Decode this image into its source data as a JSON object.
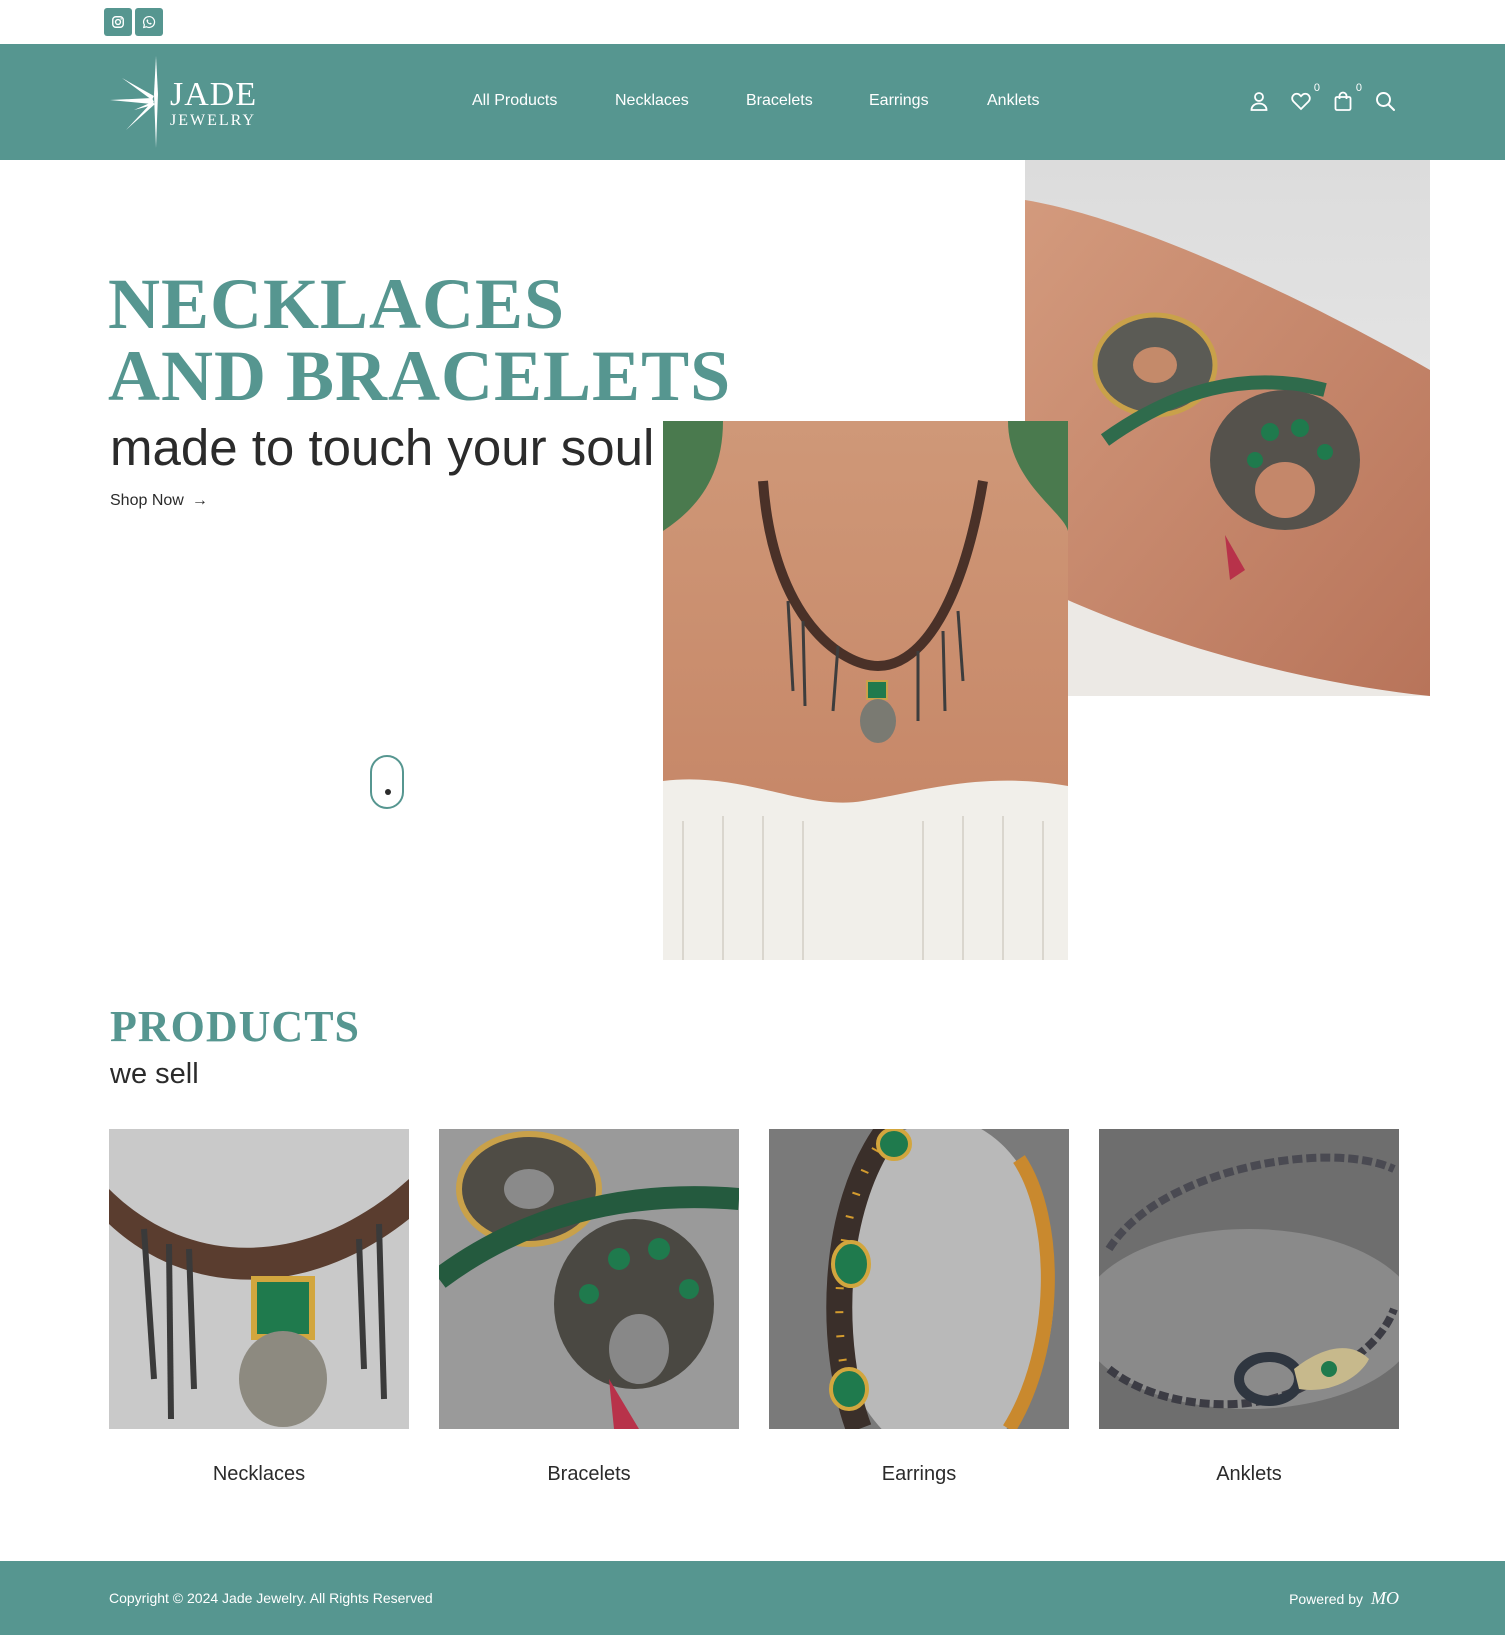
{
  "social": {
    "icons": [
      "instagram-icon",
      "whatsapp-icon"
    ]
  },
  "header": {
    "logo_word": "JADE",
    "logo_sub": "JEWELRY",
    "nav": [
      "All Products",
      "Necklaces",
      "Bracelets",
      "Earrings",
      "Anklets"
    ],
    "wishlist_count": "0",
    "cart_count": "0",
    "icons": [
      "user-icon",
      "heart-icon",
      "bag-icon",
      "search-icon"
    ]
  },
  "hero": {
    "title_line1": "NECKLACES",
    "title_line2": "AND BRACELETS",
    "subtitle": "made to touch your soul",
    "cta": "Shop Now",
    "cta_arrow": "→"
  },
  "products": {
    "title": "PRODUCTS",
    "subtitle": "we sell",
    "items": [
      {
        "label": "Necklaces"
      },
      {
        "label": "Bracelets"
      },
      {
        "label": "Earrings"
      },
      {
        "label": "Anklets"
      }
    ]
  },
  "footer": {
    "copyright": "Copyright © 2024 Jade Jewelry. All Rights Reserved",
    "powered_by": "Powered by",
    "powered_logo": "MO"
  },
  "colors": {
    "accent": "#569690",
    "text": "#2b2b2b",
    "background": "#ffffff"
  }
}
